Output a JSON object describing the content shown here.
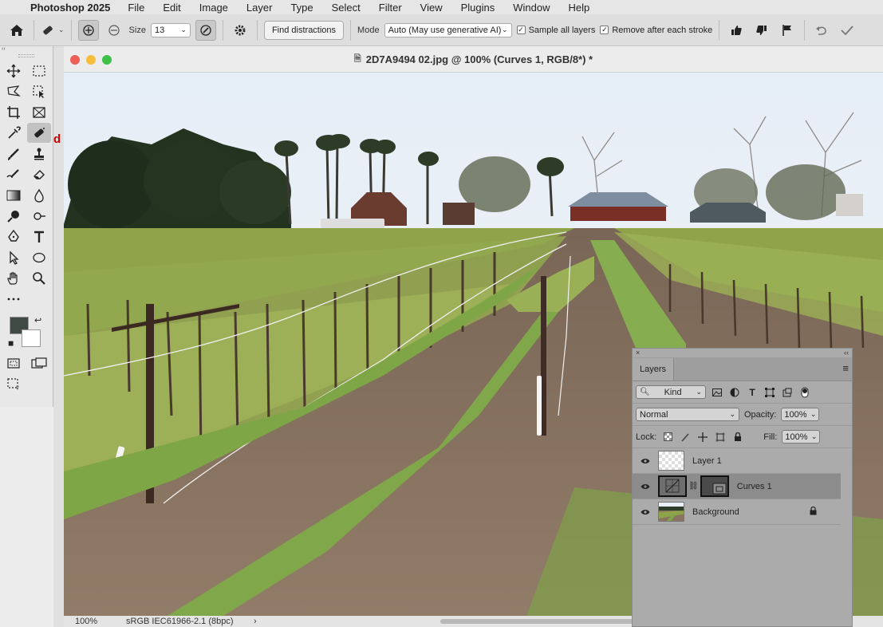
{
  "menubar": {
    "app_name": "Photoshop 2025",
    "items": [
      "File",
      "Edit",
      "Image",
      "Layer",
      "Type",
      "Select",
      "Filter",
      "View",
      "Plugins",
      "Window",
      "Help"
    ]
  },
  "options_bar": {
    "size_label": "Size",
    "size_value": "13",
    "find_distractions": "Find distractions",
    "mode_label": "Mode",
    "mode_value": "Auto (May use generative AI)",
    "sample_all_layers": "Sample all layers",
    "remove_after_each_stroke": "Remove after each stroke"
  },
  "colors": {
    "foreground": "#404a44",
    "background": "#ffffff"
  },
  "document": {
    "title": "2D7A9494 02.jpg @ 100% (Curves 1, RGB/8*) *",
    "zoom": "100%",
    "color_profile": "sRGB IEC61966-2.1 (8bpc)"
  },
  "layers_panel": {
    "tab_label": "Layers",
    "filter_kind": "Kind",
    "blend_mode": "Normal",
    "opacity_label": "Opacity:",
    "opacity_value": "100%",
    "lock_label": "Lock:",
    "fill_label": "Fill:",
    "fill_value": "100%",
    "layers": [
      {
        "name": "Layer 1"
      },
      {
        "name": "Curves 1"
      },
      {
        "name": "Background"
      }
    ]
  }
}
